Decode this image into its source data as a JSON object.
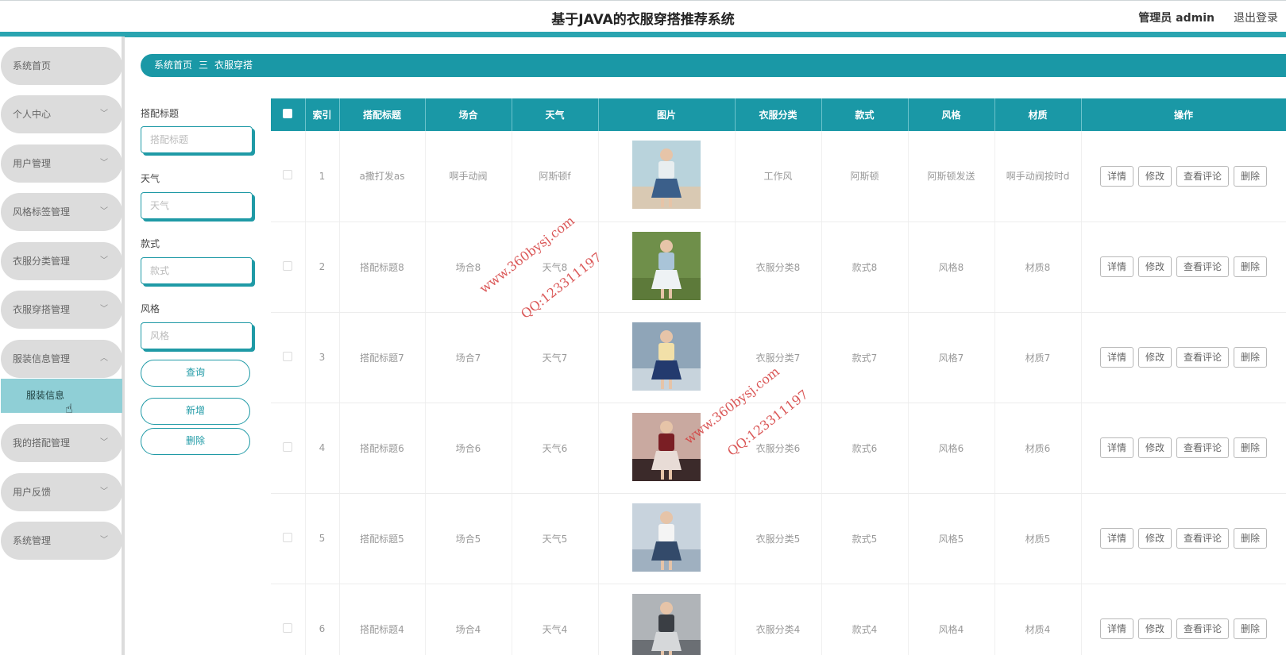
{
  "header": {
    "title": "基于JAVA的衣服穿搭推荐系统",
    "admin_label": "管理员 admin",
    "logout_label": "退出登录"
  },
  "sidebar": {
    "items": [
      {
        "label": "系统首页"
      },
      {
        "label": "个人中心"
      },
      {
        "label": "用户管理"
      },
      {
        "label": "风格标签管理"
      },
      {
        "label": "衣服分类管理"
      },
      {
        "label": "衣服穿搭管理"
      },
      {
        "label": "服装信息管理"
      },
      {
        "label": "我的搭配管理"
      },
      {
        "label": "用户反馈"
      },
      {
        "label": "系统管理"
      }
    ],
    "submenu_label": "服装信息"
  },
  "breadcrumb": {
    "home": "系统首页",
    "separator": "三",
    "current": "衣服穿搭"
  },
  "filters": {
    "title_label": "搭配标题",
    "title_placeholder": "搭配标题",
    "weather_label": "天气",
    "weather_placeholder": "天气",
    "style_label": "款式",
    "style_placeholder": "款式",
    "fashion_label": "风格",
    "fashion_placeholder": "风格",
    "search_button": "查询",
    "add_button": "新增",
    "delete_button": "删除"
  },
  "table": {
    "headers": [
      "索引",
      "搭配标题",
      "场合",
      "天气",
      "图片",
      "衣服分类",
      "款式",
      "风格",
      "材质",
      "操作"
    ],
    "rows": [
      {
        "index": "1",
        "title": "a撒打发as",
        "occasion": "啊手动阀",
        "weather": "阿斯顿f",
        "category": "工作风",
        "style": "阿斯顿",
        "fashion": "阿斯顿发送",
        "material": "啊手动阀按时d"
      },
      {
        "index": "2",
        "title": "搭配标题8",
        "occasion": "场合8",
        "weather": "天气8",
        "category": "衣服分类8",
        "style": "款式8",
        "fashion": "风格8",
        "material": "材质8"
      },
      {
        "index": "3",
        "title": "搭配标题7",
        "occasion": "场合7",
        "weather": "天气7",
        "category": "衣服分类7",
        "style": "款式7",
        "fashion": "风格7",
        "material": "材质7"
      },
      {
        "index": "4",
        "title": "搭配标题6",
        "occasion": "场合6",
        "weather": "天气6",
        "category": "衣服分类6",
        "style": "款式6",
        "fashion": "风格6",
        "material": "材质6"
      },
      {
        "index": "5",
        "title": "搭配标题5",
        "occasion": "场合5",
        "weather": "天气5",
        "category": "衣服分类5",
        "style": "款式5",
        "fashion": "风格5",
        "material": "材质5"
      },
      {
        "index": "6",
        "title": "搭配标题4",
        "occasion": "场合4",
        "weather": "天气4",
        "category": "衣服分类4",
        "style": "款式4",
        "fashion": "风格4",
        "material": "材质4"
      }
    ],
    "actions": {
      "detail": "详情",
      "edit": "修改",
      "comments": "查看评论",
      "delete": "删除"
    }
  },
  "watermark": {
    "site": "www.360bysj.com",
    "qq": "QQ:123311197"
  },
  "colors": {
    "accent": "#1a98a6",
    "submenu_bg": "#8fcfd6",
    "watermark": "#d43a3a"
  }
}
